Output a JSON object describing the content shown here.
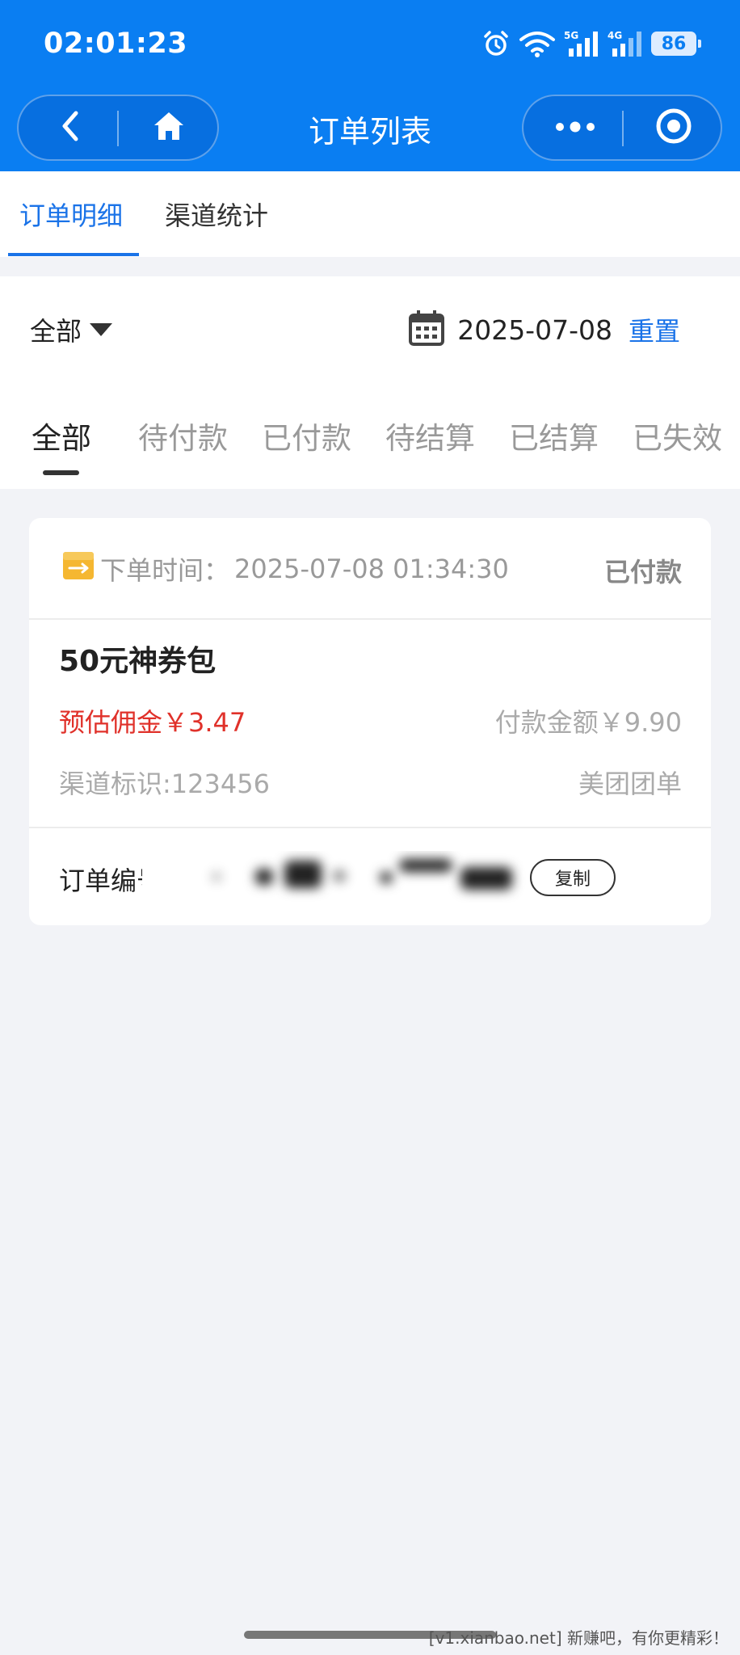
{
  "status_bar": {
    "time": "02:01:23",
    "signal_5g": "5G",
    "signal_4g": "4G",
    "battery": "86"
  },
  "nav": {
    "title": "订单列表"
  },
  "top_tabs": [
    {
      "label": "订单明细",
      "active": true
    },
    {
      "label": "渠道统计",
      "active": false
    }
  ],
  "filter": {
    "scope": "全部",
    "date": "2025-07-08",
    "reset": "重置"
  },
  "status_tabs": [
    {
      "label": "全部",
      "active": true
    },
    {
      "label": "待付款",
      "active": false
    },
    {
      "label": "已付款",
      "active": false
    },
    {
      "label": "待结算",
      "active": false
    },
    {
      "label": "已结算",
      "active": false
    },
    {
      "label": "已失效",
      "active": false
    }
  ],
  "order": {
    "time_label": "下单时间：",
    "time_value": "2025-07-08 01:34:30",
    "status": "已付款",
    "product": "50元神券包",
    "commission": "预估佣金￥3.47",
    "pay_amount": "付款金额￥9.90",
    "channel": "渠道标识:123456",
    "platform": "美团团单",
    "order_no_label": "订单编号",
    "copy": "复制"
  },
  "watermark": "[v1.xianbao.net] 新赚吧，有你更精彩！",
  "colors": {
    "header_blue": "#0a7ef2",
    "active_tab_blue": "#1a73e8",
    "commission_red": "#e0312a",
    "background": "#f2f3f7"
  }
}
